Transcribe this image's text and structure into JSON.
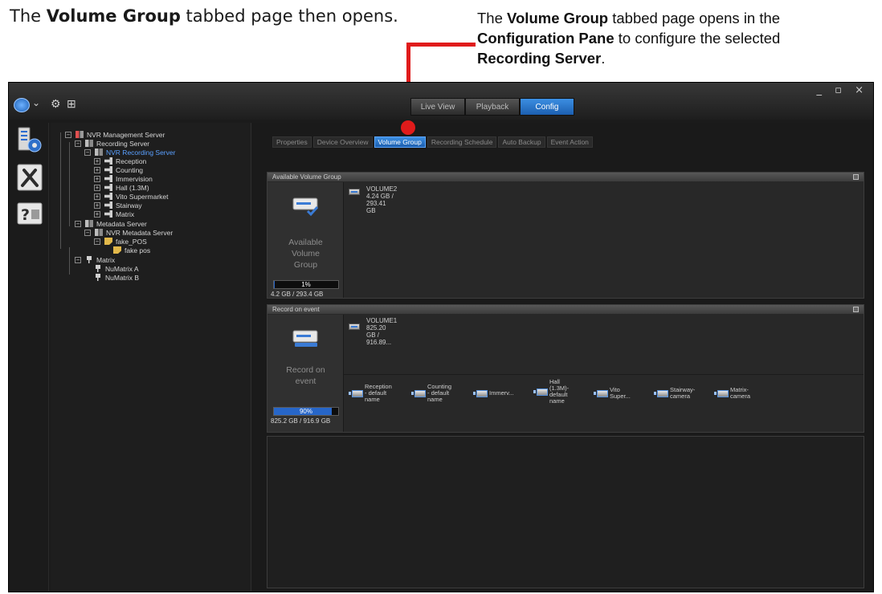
{
  "annotation": {
    "intro_pre": "The ",
    "intro_bold": "Volume Group",
    "intro_post": " tabbed page then opens.",
    "callout": {
      "t1": "The ",
      "b1": "Volume Group",
      "t2": " tabbed page opens in the ",
      "b2": "Configuration Pane",
      "t3": " to configure the selected ",
      "b3": "Recording Server",
      "t4": "."
    },
    "accent_color": "#e01b1b"
  },
  "window": {
    "controls": "_ ▫ ×",
    "mode_tabs": [
      "Live View",
      "Playback",
      "Config"
    ],
    "active_mode": "Config"
  },
  "sidebar": {
    "icons": [
      "server-config-icon",
      "tools-icon",
      "help-icon"
    ]
  },
  "tree": {
    "nodes": [
      {
        "label": "NVR Management Server"
      },
      {
        "label": "Recording Server"
      },
      {
        "label": "NVR Recording Server"
      },
      {
        "label": "Reception"
      },
      {
        "label": "Counting"
      },
      {
        "label": "Immervision"
      },
      {
        "label": "Hall (1.3M)"
      },
      {
        "label": "Vito Supermarket"
      },
      {
        "label": "Stairway"
      },
      {
        "label": "Matrix"
      },
      {
        "label": "Metadata Server"
      },
      {
        "label": "NVR Metadata Server"
      },
      {
        "label": "fake_POS"
      },
      {
        "label": "fake pos"
      },
      {
        "label": "Matrix"
      },
      {
        "label": "NuMatrix A"
      },
      {
        "label": "NuMatrix B"
      }
    ],
    "selected": "NVR Recording Server"
  },
  "config": {
    "tabs": [
      "Properties",
      "Device Overview",
      "Volume Group",
      "Recording Schedule",
      "Auto Backup",
      "Event Action"
    ],
    "active_tab": "Volume Group",
    "available_panel": {
      "title": "Available Volume Group",
      "caption_lines": [
        "Available",
        "Volume",
        "Group"
      ],
      "usage_label": "1%",
      "usage_fraction": 0.01,
      "size": "4.2 GB / 293.4 GB",
      "volume": {
        "lines": [
          "VOLUME2",
          "4.24 GB /",
          "293.41",
          "GB"
        ]
      }
    },
    "event_panel": {
      "title": "Record on event",
      "caption_lines": [
        "Record on",
        "event"
      ],
      "usage_label": "90%",
      "usage_fraction": 0.9,
      "size": "825.2 GB / 916.9 GB",
      "volume": {
        "lines": [
          "VOLUME1",
          "825.20",
          "GB /",
          "916.89..."
        ]
      },
      "cameras": [
        {
          "lines": [
            "Reception",
            "- default",
            "name"
          ]
        },
        {
          "lines": [
            "Counting",
            "- default",
            "name"
          ]
        },
        {
          "lines": [
            "Immerv..."
          ]
        },
        {
          "lines": [
            "Hall",
            "(1.3M)-",
            "default",
            "name"
          ]
        },
        {
          "lines": [
            "Vito",
            "Super..."
          ]
        },
        {
          "lines": [
            "Stairway-",
            "camera"
          ]
        },
        {
          "lines": [
            "Matrix-",
            "camera"
          ]
        }
      ]
    }
  }
}
